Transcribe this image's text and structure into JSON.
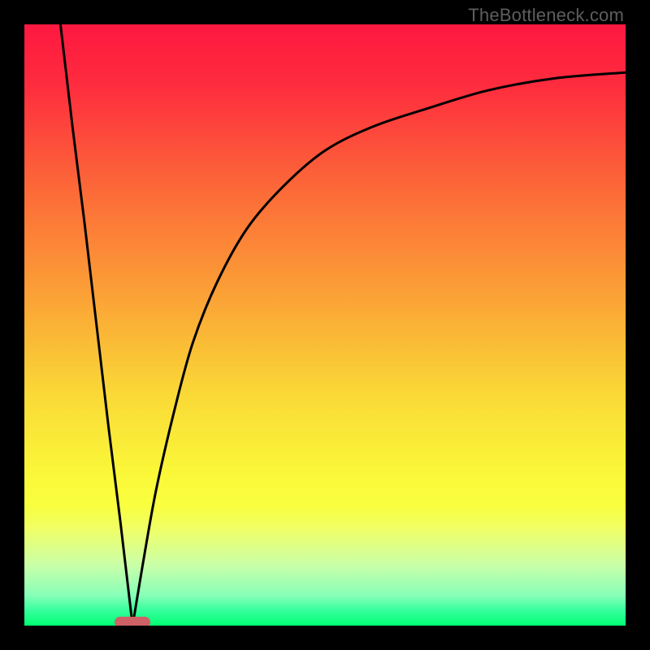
{
  "attribution": "TheBottleneck.com",
  "colors": {
    "frame": "#000000",
    "gradient_stops": [
      {
        "offset": 0.0,
        "color": "#fe1840"
      },
      {
        "offset": 0.1,
        "color": "#fe2c3e"
      },
      {
        "offset": 0.28,
        "color": "#fc6b38"
      },
      {
        "offset": 0.45,
        "color": "#fba136"
      },
      {
        "offset": 0.62,
        "color": "#fada37"
      },
      {
        "offset": 0.74,
        "color": "#faf638"
      },
      {
        "offset": 0.8,
        "color": "#f9ff3e"
      },
      {
        "offset": 0.84,
        "color": "#f0ff67"
      },
      {
        "offset": 0.9,
        "color": "#c9ffa9"
      },
      {
        "offset": 0.95,
        "color": "#86ffb8"
      },
      {
        "offset": 0.975,
        "color": "#35ff9c"
      },
      {
        "offset": 1.0,
        "color": "#01ff73"
      }
    ],
    "curve": "#000000",
    "marker": "#cd6166"
  },
  "chart_data": {
    "type": "line",
    "title": "",
    "xlabel": "",
    "ylabel": "",
    "xlim": [
      0,
      100
    ],
    "ylim": [
      0,
      100
    ],
    "note": "V-shaped bottleneck curve. Y is mismatch percentage (0=bottom/green=ideal, 100=top/red=severe). Minimum at x≈18.",
    "series": [
      {
        "name": "left-branch",
        "x": [
          6,
          8,
          10,
          12,
          14,
          16,
          18
        ],
        "values": [
          100,
          83,
          67,
          50,
          33,
          17,
          0
        ]
      },
      {
        "name": "right-branch",
        "x": [
          18,
          20,
          22,
          25,
          28,
          32,
          37,
          43,
          50,
          58,
          67,
          77,
          88,
          100
        ],
        "values": [
          0,
          12,
          23,
          36,
          47,
          57,
          66,
          73,
          79,
          83,
          86,
          89,
          91,
          92
        ]
      }
    ],
    "marker": {
      "x_center": 18,
      "x_width": 6,
      "y": 0,
      "label": "optimal-range"
    }
  }
}
